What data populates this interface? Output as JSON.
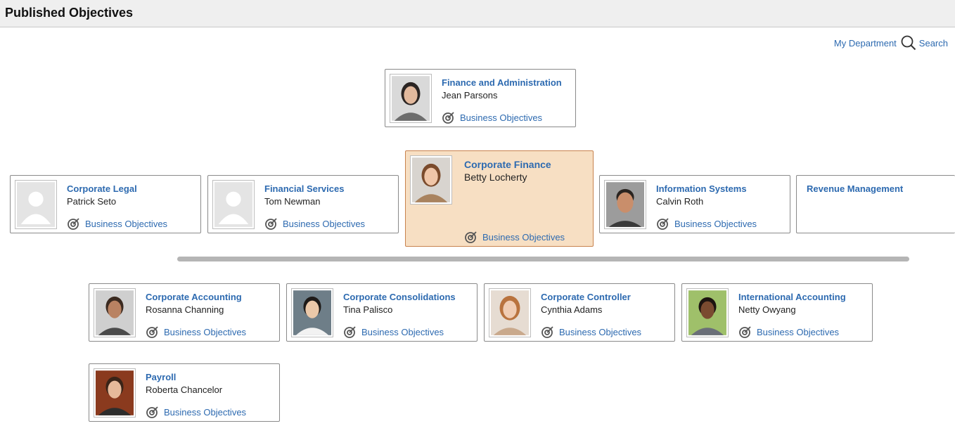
{
  "header": {
    "title": "Published Objectives"
  },
  "toolbar": {
    "my_department": "My Department",
    "search": "Search"
  },
  "cards": {
    "manager": {
      "title": "Finance and Administration",
      "name": "Jean Parsons",
      "link": "Business Objectives"
    },
    "peer_legal": {
      "title": "Corporate Legal",
      "name": "Patrick Seto",
      "link": "Business Objectives"
    },
    "peer_financial": {
      "title": "Financial Services",
      "name": "Tom Newman",
      "link": "Business Objectives"
    },
    "current": {
      "title": "Corporate Finance",
      "name": "Betty Locherty",
      "link": "Business Objectives"
    },
    "peer_info": {
      "title": "Information Systems",
      "name": "Calvin Roth",
      "link": "Business Objectives"
    },
    "peer_revenue": {
      "title": "Revenue Management"
    },
    "report_accounting": {
      "title": "Corporate Accounting",
      "name": "Rosanna Channing",
      "link": "Business Objectives"
    },
    "report_consolidations": {
      "title": "Corporate Consolidations",
      "name": "Tina Palisco",
      "link": "Business Objectives"
    },
    "report_controller": {
      "title": "Corporate Controller",
      "name": "Cynthia Adams",
      "link": "Business Objectives"
    },
    "report_intl": {
      "title": "International Accounting",
      "name": "Netty Owyang",
      "link": "Business Objectives"
    },
    "report_payroll": {
      "title": "Payroll",
      "name": "Roberta Chancelor",
      "link": "Business Objectives"
    }
  },
  "icons": {
    "search": "search-icon",
    "objective": "target-icon",
    "placeholder": "person-placeholder-icon"
  },
  "colors": {
    "link": "#2d6ab0",
    "current_bg": "#f7dfc3",
    "current_border": "#c8824e"
  }
}
